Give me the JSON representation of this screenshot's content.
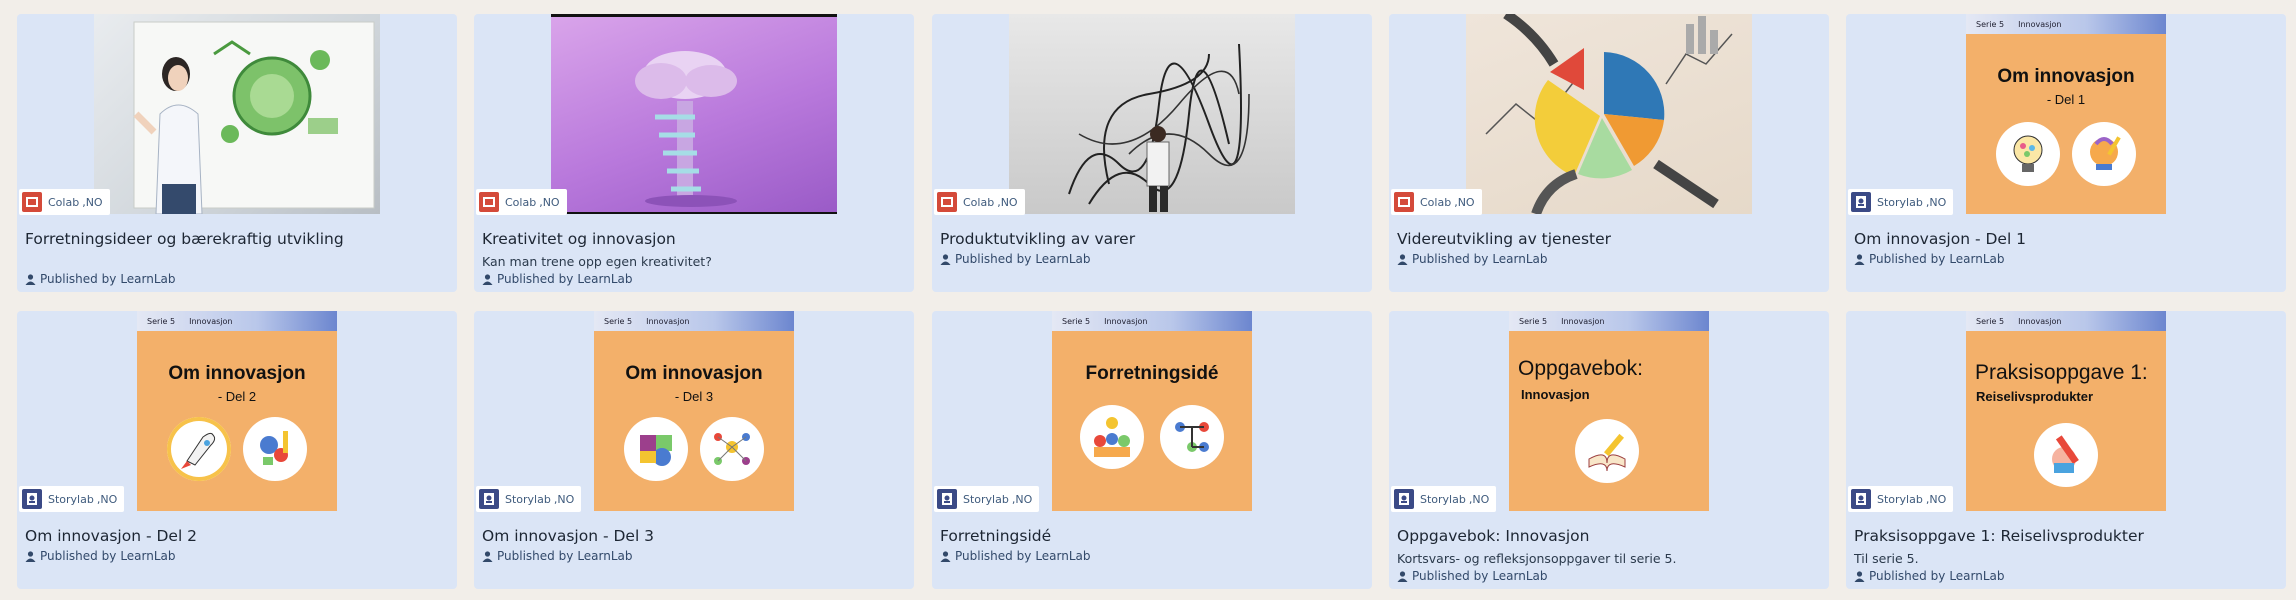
{
  "publisher_prefix": "Published by",
  "publisher_name": "LearnLab",
  "cards": [
    {
      "title": "Forretningsideer og bærekraftig utvikling",
      "subtitle": "",
      "source": "Colab",
      "region": ",NO"
    },
    {
      "title": "Kreativitet og innovasjon",
      "subtitle": "Kan man trene opp egen kreativitet?",
      "source": "Colab",
      "region": ",NO"
    },
    {
      "title": "Produktutvikling av varer",
      "subtitle": "",
      "source": "Colab",
      "region": ",NO"
    },
    {
      "title": "Videreutvikling av tjenester",
      "subtitle": "",
      "source": "Colab",
      "region": ",NO"
    },
    {
      "title": "Om innovasjon - Del 1",
      "subtitle": "",
      "source": "Storylab",
      "region": ",NO",
      "cover": {
        "band_left": "Serie 5",
        "band_right": "Innovasjon",
        "title": "Om innovasjon",
        "sub": "- Del 1"
      }
    },
    {
      "title": "Om innovasjon - Del 2",
      "subtitle": "",
      "source": "Storylab",
      "region": ",NO",
      "cover": {
        "band_left": "Serie 5",
        "band_right": "Innovasjon",
        "title": "Om innovasjon",
        "sub": "- Del 2"
      }
    },
    {
      "title": "Om innovasjon - Del 3",
      "subtitle": "",
      "source": "Storylab",
      "region": ",NO",
      "cover": {
        "band_left": "Serie 5",
        "band_right": "Innovasjon",
        "title": "Om innovasjon",
        "sub": "- Del 3"
      }
    },
    {
      "title": "Forretningsidé",
      "subtitle": "",
      "source": "Storylab",
      "region": ",NO",
      "cover": {
        "band_left": "Serie 5",
        "band_right": "Innovasjon",
        "title": "Forretningsidé",
        "sub": ""
      }
    },
    {
      "title": "Oppgavebok: Innovasjon",
      "subtitle": "Kortsvars- og refleksjonsoppgaver til serie 5.",
      "source": "Storylab",
      "region": ",NO",
      "cover": {
        "band_left": "Serie 5",
        "band_right": "Innovasjon",
        "title": "Oppgavebok:",
        "sub": "Innovasjon"
      }
    },
    {
      "title": "Praksisoppgave 1: Reiselivsprodukter",
      "subtitle": "Til serie 5.",
      "source": "Storylab",
      "region": ",NO",
      "cover": {
        "band_left": "Serie 5",
        "band_right": "Innovasjon",
        "title": "Praksisoppgave 1:",
        "sub": "Reiselivsprodukter"
      }
    }
  ],
  "colors": {
    "card_bg": "#dbe5f6",
    "cover_orange": "#f3b06a",
    "page_bg": "#f2eee9"
  }
}
